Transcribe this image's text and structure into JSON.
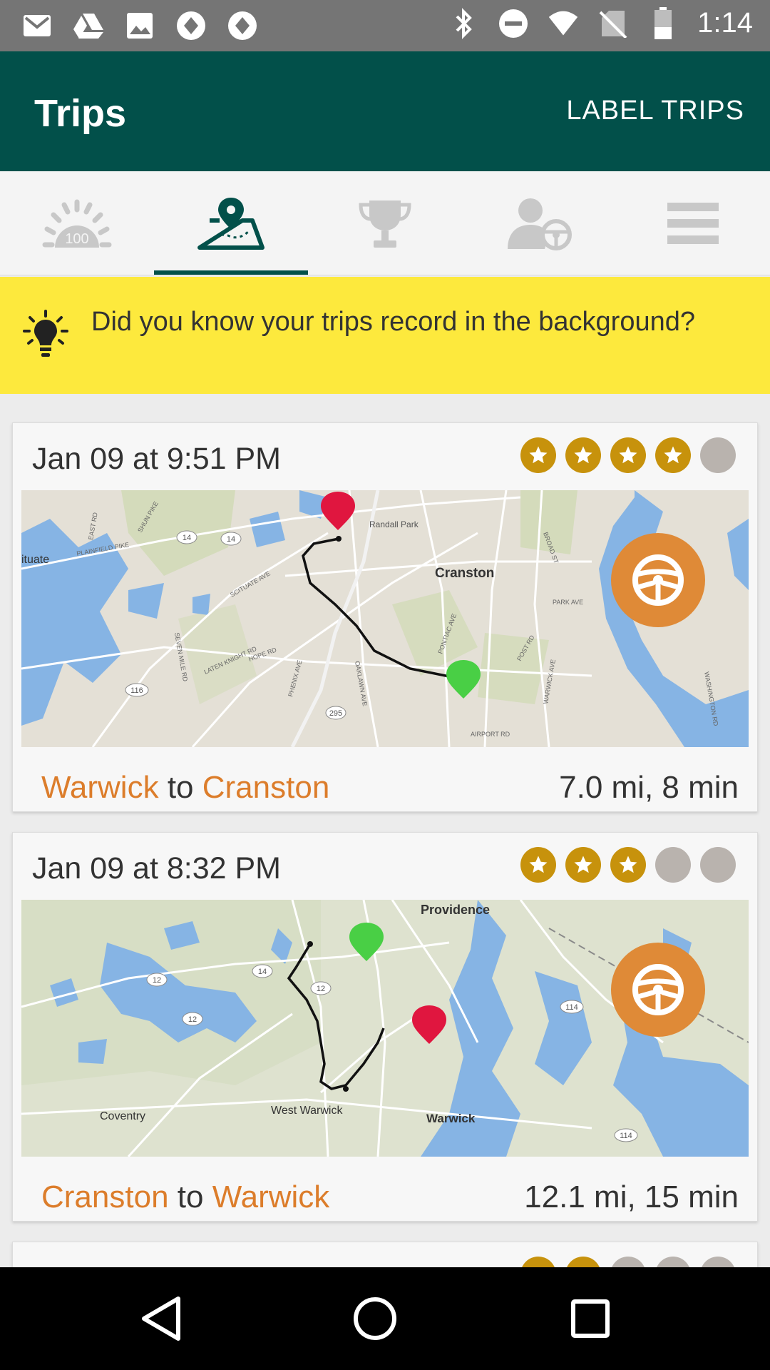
{
  "status_bar": {
    "time": "1:14",
    "left_icons": [
      "gmail-icon",
      "drive-icon",
      "image-icon",
      "sync-icon",
      "sync-icon"
    ],
    "right_icons": [
      "bluetooth-icon",
      "do-not-disturb-icon",
      "wifi-icon",
      "no-sim-icon",
      "battery-icon"
    ]
  },
  "app_bar": {
    "title": "Trips",
    "action_label": "LABEL TRIPS"
  },
  "tabs": [
    {
      "name": "score",
      "icon": "score-gauge-icon",
      "badge": "100",
      "active": false
    },
    {
      "name": "trips",
      "icon": "map-pin-icon",
      "active": true
    },
    {
      "name": "rewards",
      "icon": "trophy-icon",
      "active": false
    },
    {
      "name": "profile",
      "icon": "driver-profile-icon",
      "active": false
    },
    {
      "name": "menu",
      "icon": "menu-icon",
      "active": false
    }
  ],
  "tip": {
    "icon": "lightbulb-icon",
    "text": "Did you know your trips record in the background?"
  },
  "trips": [
    {
      "date": "Jan 09 at 9:51 PM",
      "stars_filled": 4,
      "stars_total": 5,
      "from": "Warwick",
      "connector": "to",
      "to": "Cranston",
      "distance_time": "7.0 mi, 8 min",
      "map_labels": {
        "main": "Cranston",
        "park": "Randall Park",
        "west": "ituate",
        "roads": [
          "PLAINFIELD PIKE",
          "SCITUATE AVE",
          "HOPE RD",
          "PONTIAC AVE",
          "PARK AVE",
          "POST RD",
          "AIRPORT RD",
          "BROAD ST",
          "SEVEN MILE RD",
          "LATEN KNIGHT RD",
          "PHENIX AVE",
          "OAKLAWN AVE",
          "WARWICK AVE",
          "WASHINGTON RD",
          "SHUN PIKE",
          "EAST RD"
        ],
        "shields": [
          "14",
          "14",
          "116",
          "295"
        ]
      }
    },
    {
      "date": "Jan 09 at 8:32 PM",
      "stars_filled": 3,
      "stars_total": 5,
      "from": "Cranston",
      "connector": "to",
      "to": "Warwick",
      "distance_time": "12.1 mi, 15 min",
      "map_labels": {
        "top": "Providence",
        "west": "West Warwick",
        "south": "Warwick",
        "coventry": "Coventry",
        "shields": [
          "12",
          "12",
          "12",
          "14",
          "114",
          "114"
        ]
      }
    }
  ],
  "colors": {
    "app_bar": "#02504a",
    "accent_orange": "#dc7d2b",
    "star_on": "#c7920c",
    "star_off": "#b9b3ae",
    "tip_bg": "#fde93d",
    "drive_button": "#df8a37"
  }
}
